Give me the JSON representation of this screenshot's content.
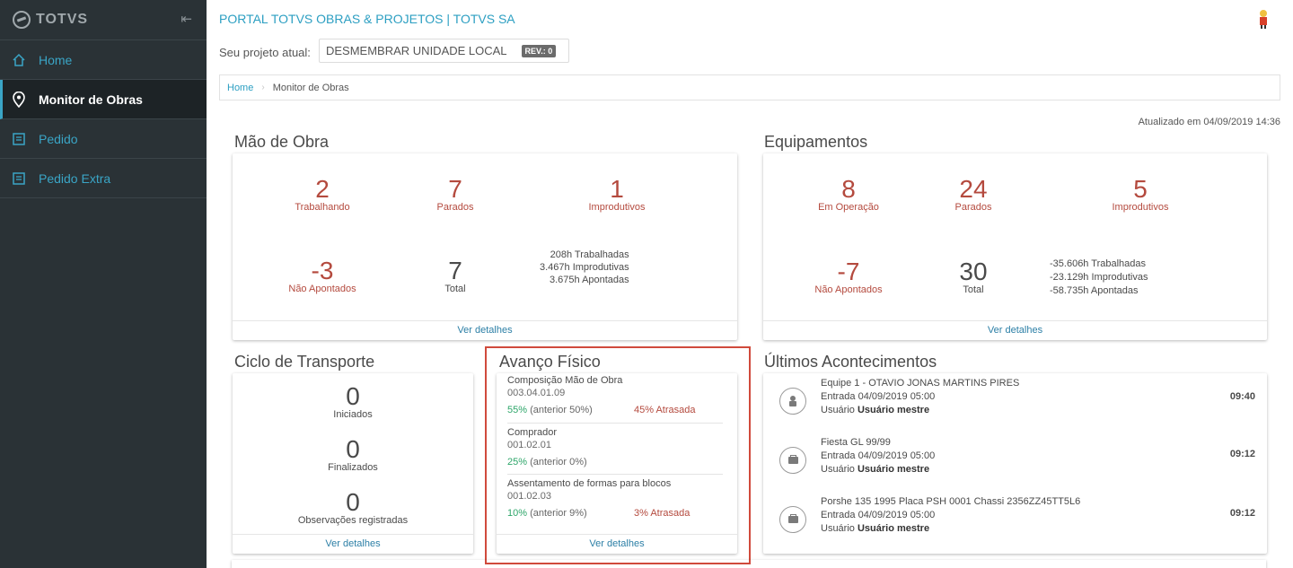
{
  "sidebar": {
    "brand": "TOTVS",
    "items": [
      {
        "label": "Home",
        "icon": "home-icon",
        "active": false
      },
      {
        "label": "Monitor de Obras",
        "icon": "location-pin-icon",
        "active": true
      },
      {
        "label": "Pedido",
        "icon": "document-list-icon",
        "active": false
      },
      {
        "label": "Pedido Extra",
        "icon": "document-list-icon",
        "active": false
      }
    ]
  },
  "header": {
    "portal_title": "PORTAL TOTVS OBRAS & PROJETOS | TOTVS SA",
    "project_label": "Seu projeto atual:",
    "project_name": "DESMEMBRAR UNIDADE LOCAL",
    "rev_badge": "REV.: 0"
  },
  "breadcrumb": {
    "home": "Home",
    "current": "Monitor de Obras"
  },
  "updated": "Atualizado em 04/09/2019 14:36",
  "mao_de_obra": {
    "title": "Mão de Obra",
    "trabalhando": {
      "value": "2",
      "label": "Trabalhando"
    },
    "parados": {
      "value": "7",
      "label": "Parados"
    },
    "improdutivos": {
      "value": "1",
      "label": "Improdutivos"
    },
    "nao_apontados": {
      "value": "-3",
      "label": "Não Apontados"
    },
    "total": {
      "value": "7",
      "label": "Total"
    },
    "hours": [
      "208h Trabalhadas",
      "3.467h Improdutivas",
      "3.675h Apontadas"
    ],
    "details": "Ver detalhes"
  },
  "equipamentos": {
    "title": "Equipamentos",
    "em_operacao": {
      "value": "8",
      "label": "Em Operação"
    },
    "parados": {
      "value": "24",
      "label": "Parados"
    },
    "improdutivos": {
      "value": "5",
      "label": "Improdutivos"
    },
    "nao_apontados": {
      "value": "-7",
      "label": "Não Apontados"
    },
    "total": {
      "value": "30",
      "label": "Total"
    },
    "hours": [
      "-35.606h Trabalhadas",
      "-23.129h Improdutivas",
      "-58.735h Apontadas"
    ],
    "details": "Ver detalhes"
  },
  "ciclo": {
    "title": "Ciclo de Transporte",
    "iniciados": {
      "value": "0",
      "label": "Iniciados"
    },
    "finalizados": {
      "value": "0",
      "label": "Finalizados"
    },
    "observacoes": {
      "value": "0",
      "label": "Observações registradas"
    },
    "details": "Ver detalhes"
  },
  "avanco": {
    "title": "Avanço Físico",
    "items": [
      {
        "title": "Composição Mão de Obra",
        "code": "003.04.01.09",
        "pct": "55%",
        "anterior": "(anterior 50%)",
        "late": "45% Atrasada"
      },
      {
        "title": "Comprador",
        "code": "001.02.01",
        "pct": "25%",
        "anterior": "(anterior 0%)",
        "late": ""
      },
      {
        "title": "Assentamento de formas para blocos",
        "code": "001.02.03",
        "pct": "10%",
        "anterior": "(anterior 9%)",
        "late": "3% Atrasada"
      }
    ],
    "details": "Ver detalhes"
  },
  "eventos": {
    "title": "Últimos Acontecimentos",
    "items": [
      {
        "title": "Equipe 1 - OTAVIO JONAS MARTINS PIRES",
        "entrada": "Entrada 04/09/2019 05:00",
        "usuario_label": "Usuário",
        "usuario": "Usuário mestre",
        "time": "09:40",
        "icon": "person-icon"
      },
      {
        "title": "Fiesta GL 99/99",
        "entrada": "Entrada 04/09/2019 05:00",
        "usuario_label": "Usuário",
        "usuario": "Usuário mestre",
        "time": "09:12",
        "icon": "equipment-icon"
      },
      {
        "title": "Porshe 135 1995 Placa PSH 0001 Chassi 2356ZZ45TT5L6",
        "entrada": "Entrada 04/09/2019 05:00",
        "usuario_label": "Usuário",
        "usuario": "Usuário mestre",
        "time": "09:12",
        "icon": "equipment-icon"
      }
    ]
  }
}
